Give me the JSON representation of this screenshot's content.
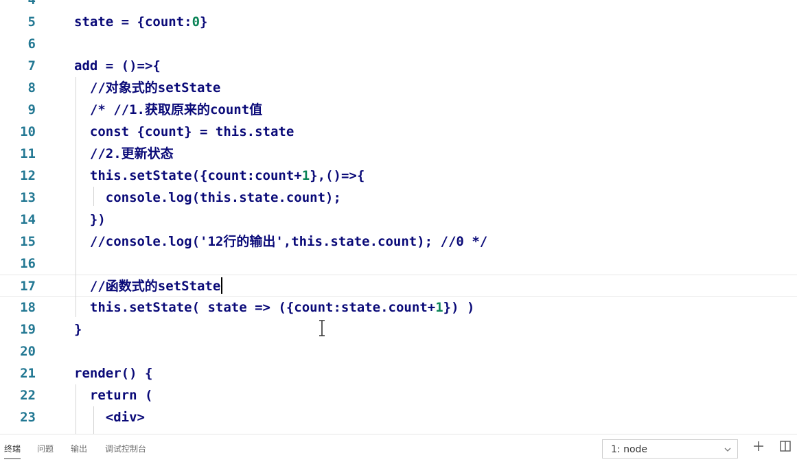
{
  "editor": {
    "lines": [
      {
        "n": "4",
        "code": ""
      },
      {
        "n": "5",
        "code": "state = {count:0}"
      },
      {
        "n": "6",
        "code": ""
      },
      {
        "n": "7",
        "code": "add = ()=>{"
      },
      {
        "n": "8",
        "code": "  //对象式的setState"
      },
      {
        "n": "9",
        "code": "  /* //1.获取原来的count值"
      },
      {
        "n": "10",
        "code": "  const {count} = this.state"
      },
      {
        "n": "11",
        "code": "  //2.更新状态"
      },
      {
        "n": "12",
        "code": "  this.setState({count:count+1},()=>{"
      },
      {
        "n": "13",
        "code": "    console.log(this.state.count);"
      },
      {
        "n": "14",
        "code": "  })"
      },
      {
        "n": "15",
        "code": "  //console.log('12行的输出',this.state.count); //0 */"
      },
      {
        "n": "16",
        "code": ""
      },
      {
        "n": "17",
        "code": "  //函数式的setState"
      },
      {
        "n": "18",
        "code": "  this.setState( state => ({count:state.count+1}) )"
      },
      {
        "n": "19",
        "code": "}"
      },
      {
        "n": "20",
        "code": ""
      },
      {
        "n": "21",
        "code": "render() {"
      },
      {
        "n": "22",
        "code": "  return ("
      },
      {
        "n": "23",
        "code": "    <div>"
      }
    ],
    "current_line": "17",
    "colors": {
      "line_number": "#237893",
      "code": "#0a0a78",
      "number_literal": "#0b8457",
      "background": "#ffffff"
    }
  },
  "panel": {
    "tabs": [
      "终端",
      "问题",
      "输出",
      "调试控制台"
    ],
    "active_tab": "终端",
    "terminal_select": "1: node",
    "icons": [
      "chevron-down-icon",
      "plus-icon",
      "split-terminal-icon"
    ]
  }
}
